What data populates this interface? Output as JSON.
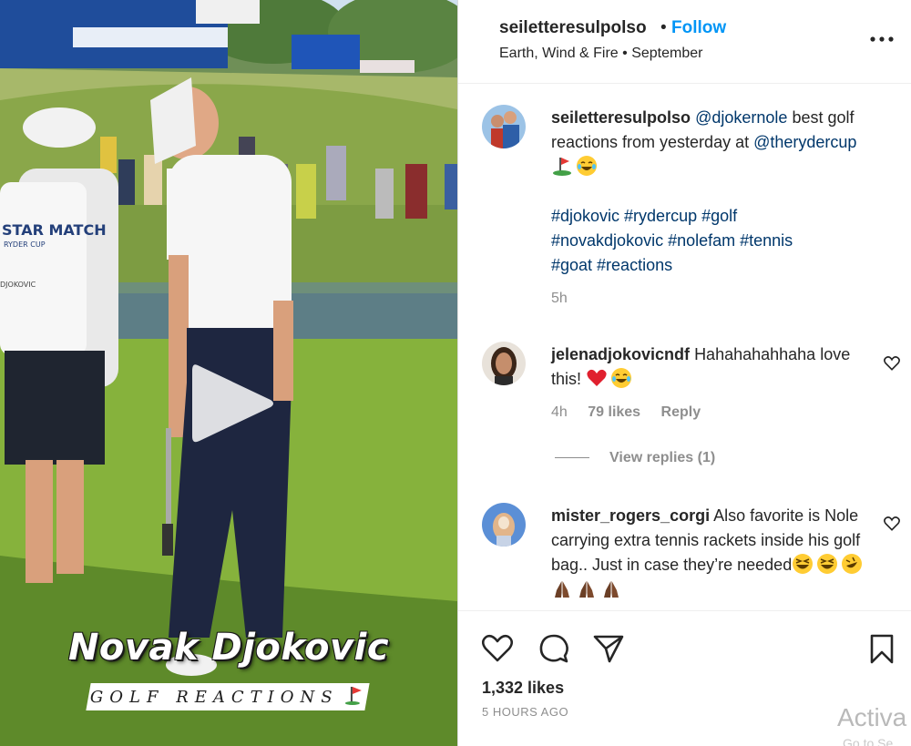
{
  "colors": {
    "link": "#0095f6",
    "mention": "#00376b",
    "muted": "#8e8e8e",
    "heart": "#ed4956"
  },
  "media": {
    "overlay_title": "Novak Djokovic",
    "overlay_subtitle": "GOLF REACTIONS",
    "caddie_bib_text": "STAR MATCH",
    "caddie_bib_small": "RYDER CUP",
    "caddie_bib_name": "DJOKOVIC",
    "play_icon": "play-icon"
  },
  "header": {
    "username": "seiletteresulpolso",
    "dot": "•",
    "follow": "Follow",
    "subtitle": "Earth, Wind & Fire • September",
    "more_icon": "more-horizontal-icon"
  },
  "caption": {
    "username": "seiletteresulpolso",
    "mention1": "@djokernole",
    "text1": "best golf reactions from yesterday at",
    "mention2": "@therydercup",
    "hashtags_line1": "#djokovic #rydercup #golf",
    "hashtags_line2": "#novakdjokovic #nolefam #tennis",
    "hashtags_line3": "#goat #reactions",
    "time": "5h"
  },
  "comments": [
    {
      "username": "jelenadjokovicndf",
      "text_line1": "Hahahahahhaha",
      "text_line2": "love this!",
      "time": "4h",
      "likes": "79 likes",
      "reply": "Reply",
      "view_replies": "View replies (1)"
    },
    {
      "username": "mister_rogers_corgi",
      "text_part1": "Also favorite is",
      "text_part2": "Nole carrying extra tennis rackets",
      "text_part3": "inside his golf bag.. Just in case",
      "text_part4": "they’re needed"
    }
  ],
  "actions": {
    "like_icon": "heart-icon",
    "comment_icon": "comment-icon",
    "share_icon": "send-icon",
    "save_icon": "bookmark-icon",
    "likes": "1,332 likes",
    "time": "5 HOURS AGO"
  },
  "watermark": {
    "line1": "Activa",
    "line2": "Go to Se"
  }
}
